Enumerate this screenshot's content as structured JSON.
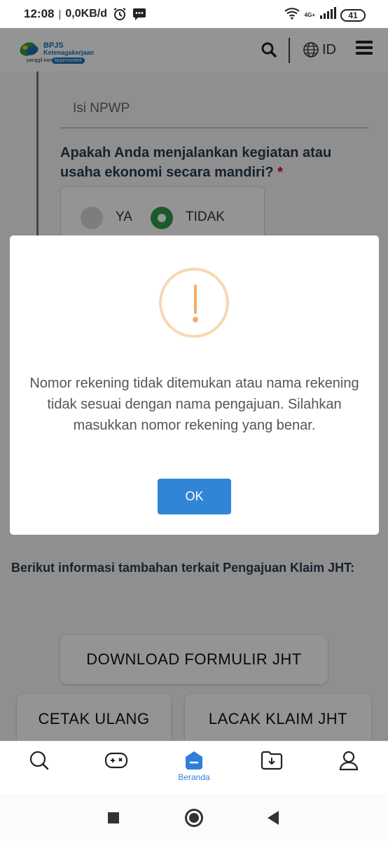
{
  "status_bar": {
    "time": "12:08",
    "separator": "|",
    "speed": "0,0KB/d",
    "network": "4G+",
    "battery": "41"
  },
  "header": {
    "logo": {
      "title": "BPJS",
      "subtitle": "Ketenagakerjaan",
      "tagline": "panggil kami",
      "tag": "bpjamsostek"
    },
    "language": "ID"
  },
  "form": {
    "npwp_placeholder": "Isi NPWP",
    "question": "Apakah Anda menjalankan kegiatan atau usaha ekonomi secara mandiri?",
    "required_mark": "*",
    "options": [
      {
        "label": "YA",
        "selected": false
      },
      {
        "label": "TIDAK",
        "selected": true
      }
    ]
  },
  "info": {
    "text": "Berikut informasi tambahan terkait Pengajuan Klaim JHT:",
    "buttons": {
      "download": "DOWNLOAD FORMULIR JHT",
      "cetak": "CETAK ULANG",
      "lacak": "LACAK KLAIM JHT"
    }
  },
  "modal": {
    "icon": "warning-icon",
    "message": "Nomor rekening tidak ditemukan atau nama rekening tidak sesuai dengan nama pengajuan. Silahkan masukkan nomor rekening yang benar.",
    "ok_label": "OK",
    "ok_color": "#3085d6"
  },
  "bottom_nav": {
    "items": [
      {
        "icon": "search-icon",
        "label": ""
      },
      {
        "icon": "gamepad-icon",
        "label": ""
      },
      {
        "icon": "home-icon",
        "label": "Beranda",
        "active": true
      },
      {
        "icon": "download-folder-icon",
        "label": ""
      },
      {
        "icon": "profile-icon",
        "label": ""
      }
    ],
    "active_color": "#2f7fd8"
  }
}
